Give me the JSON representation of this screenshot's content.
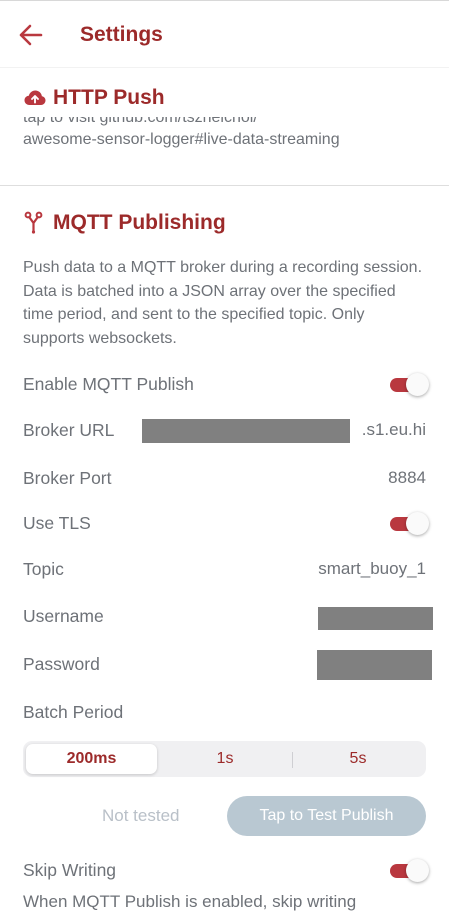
{
  "appbar": {
    "title": "Settings"
  },
  "http_push": {
    "heading": "HTTP Push",
    "link_line1": "tap to visit github.com/tszheichoi/",
    "link_line2": "awesome-sensor-logger#live-data-streaming"
  },
  "mqtt": {
    "heading": "MQTT Publishing",
    "description": "Push data to a MQTT broker during a recording session. Data is batched into a JSON array over the specified time period, and sent to the specified topic. Only supports websockets.",
    "enable_label": "Enable MQTT Publish",
    "enable_on": true,
    "broker_url_label": "Broker URL",
    "broker_url_visible_suffix": ".s1.eu.hi",
    "broker_port_label": "Broker Port",
    "broker_port_value": "8884",
    "use_tls_label": "Use TLS",
    "use_tls_on": true,
    "topic_label": "Topic",
    "topic_value": "smart_buoy_1",
    "username_label": "Username",
    "password_label": "Password",
    "batch_period_label": "Batch Period",
    "batch_options": [
      "200ms",
      "1s",
      "5s"
    ],
    "batch_selected": "200ms",
    "test_status": "Not tested",
    "test_button": "Tap to Test Publish",
    "skip_writing_label": "Skip Writing",
    "skip_writing_on": true,
    "skip_writing_desc": "When MQTT Publish is enabled, skip writing"
  },
  "colors": {
    "accent": "#9c2a2a",
    "switch_on": "#b9383f",
    "text": "#6e7278",
    "button_disabled": "#b9c8d2"
  },
  "icons": {
    "back": "arrow-left-icon",
    "http": "cloud-upload-icon",
    "mqtt": "network-fork-icon"
  }
}
